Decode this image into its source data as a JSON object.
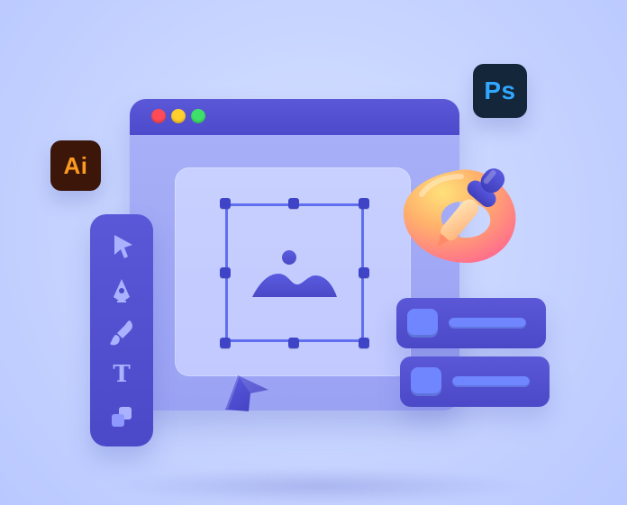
{
  "badges": {
    "ai": {
      "label": "Ai",
      "bg": "#3b1609",
      "fg": "#ff9a20"
    },
    "ps": {
      "label": "Ps",
      "bg": "#13263a",
      "fg": "#31a8ff"
    }
  },
  "window": {
    "traffic_lights": [
      "red",
      "yellow",
      "green"
    ]
  },
  "toolbar": {
    "tools": [
      {
        "icon": "selection-arrow-icon"
      },
      {
        "icon": "pen-tool-icon"
      },
      {
        "icon": "brush-icon"
      },
      {
        "icon": "text-tool-icon",
        "glyph": "T"
      },
      {
        "icon": "layers-icon"
      }
    ]
  },
  "colors": {
    "background": "#c9d6ff",
    "window": "#8f97f2",
    "window_titlebar": "#5b58d8",
    "canvas": "#c8d0ff",
    "accent": "#5f6ff0",
    "panel": "#5b58d8",
    "panel_chip": "#6f86ff"
  }
}
